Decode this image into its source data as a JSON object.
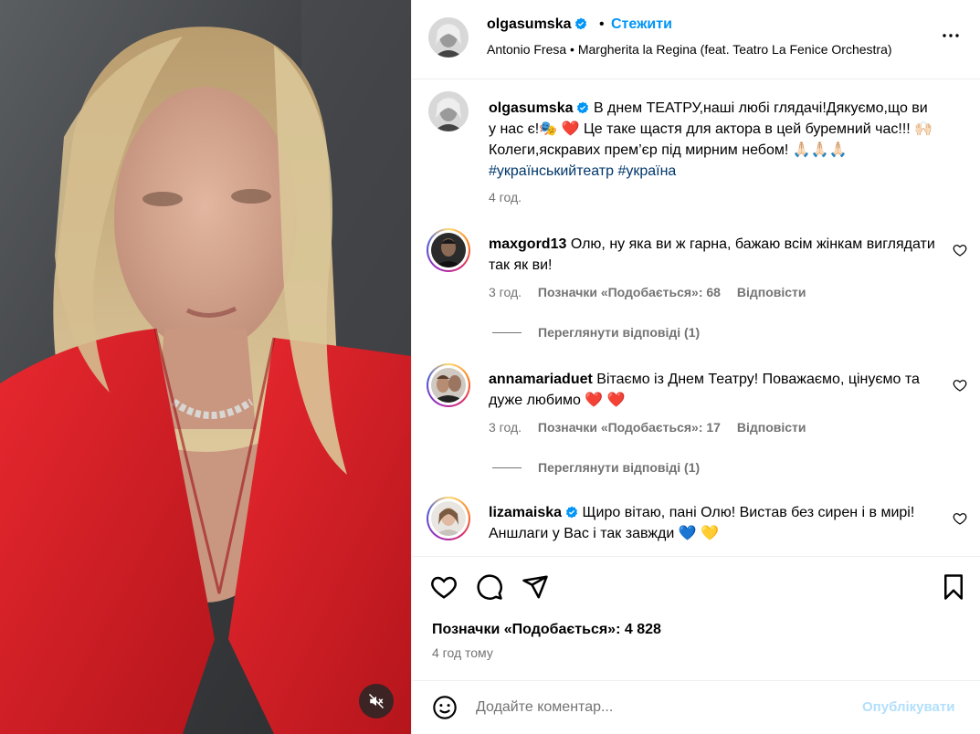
{
  "post": {
    "username": "olgasumska",
    "dot": "•",
    "follow_label": "Стежити",
    "audio": "Antonio Fresa • Margherita la Regina (feat. Teatro La Fenice Orchestra)"
  },
  "caption": {
    "username": "olgasumska",
    "text": "В днем ТЕАТРУ,наші любі глядачі!Дякуємо,що ви у нас є!🎭 ❤️ Це таке щастя для актора в цей буремний час!!! 🙌🏻 Колеги,яскравих прем’єр під мирним небом! 🙏🏻🙏🏻🙏🏻",
    "hashtags": "#українськийтеатр #україна",
    "time": "4 год."
  },
  "comments": [
    {
      "username": "maxgord13",
      "text": "Олю, ну яка ви ж гарна, бажаю всім жінкам виглядати так як ви!",
      "time": "3 год.",
      "likes": "Позначки «Подобається»: 68",
      "reply": "Відповісти",
      "view_replies": "Переглянути відповіді (1)"
    },
    {
      "username": "annamariaduet",
      "text": "Вітаємо із Днем Театру! Поважаємо, цінуємо та дуже любимо ❤️ ❤️",
      "time": "3 год.",
      "likes": "Позначки «Подобається»: 17",
      "reply": "Відповісти",
      "view_replies": "Переглянути відповіді (1)"
    },
    {
      "username": "lizamaiska",
      "text": "Щиро вітаю, пані Олю! Вистав без сирен і в мирі! Аншлаги у Вас і так завжди 💙 💛",
      "verified": true
    }
  ],
  "footer": {
    "likes": "Позначки «Подобається»: 4 828",
    "time": "4 год тому",
    "comment_placeholder": "Додайте коментар...",
    "post_label": "Опублікувати"
  },
  "colors": {
    "accent": "#0095f6",
    "link": "#00376b",
    "muted": "#737373",
    "verified": "#0095f6",
    "heart": "#ff3040"
  },
  "icons": [
    "mute-icon",
    "more-icon",
    "verified-badge-icon",
    "heart-icon",
    "comment-icon",
    "share-icon",
    "bookmark-icon",
    "emoji-icon"
  ]
}
